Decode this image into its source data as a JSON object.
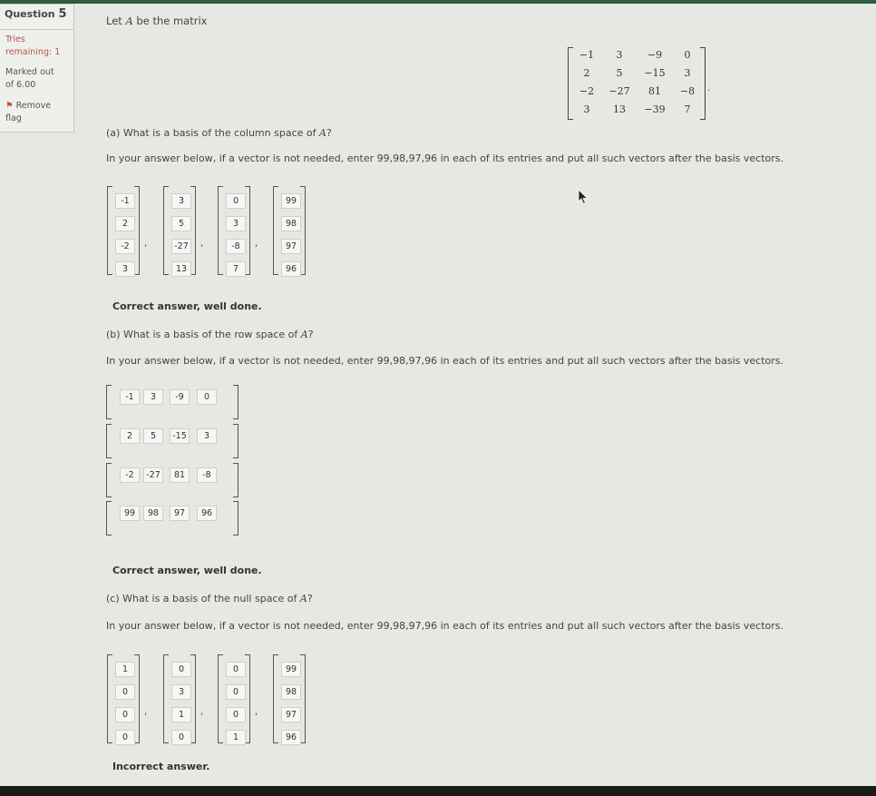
{
  "sidebar": {
    "question_label": "Question",
    "question_number": "5",
    "tries_line1": "Tries",
    "tries_line2": "remaining: 1",
    "marked_line1": "Marked out",
    "marked_line2": "of 6.00",
    "flag_label": "Remove",
    "flag_label2": "flag"
  },
  "intro": {
    "prefix": "Let",
    "var": "A",
    "suffix": "be the matrix"
  },
  "matrix_A": [
    [
      "−1",
      "3",
      "−9",
      "0"
    ],
    [
      "2",
      "5",
      "−15",
      "3"
    ],
    [
      "−2",
      "−27",
      "81",
      "−8"
    ],
    [
      "3",
      "13",
      "−39",
      "7"
    ]
  ],
  "instruction": "In your answer below, if a vector is not needed, enter 99,98,97,96 in each of its entries and put all such vectors after the basis vectors.",
  "part_a": {
    "question_prefix": "(a) What is a basis of the column space of",
    "var": "A",
    "qmark": "?",
    "vectors": [
      [
        "-1",
        "2",
        "-2",
        "3"
      ],
      [
        "3",
        "5",
        "-27",
        "13"
      ],
      [
        "0",
        "3",
        "-8",
        "7"
      ],
      [
        "99",
        "98",
        "97",
        "96"
      ]
    ],
    "feedback": "Correct answer, well done."
  },
  "part_b": {
    "question_prefix": "(b) What is a basis of the row space of",
    "var": "A",
    "qmark": "?",
    "vectors": [
      [
        "-1",
        "3",
        "-9",
        "0"
      ],
      [
        "2",
        "5",
        "-15",
        "3"
      ],
      [
        "-2",
        "-27",
        "81",
        "-8"
      ],
      [
        "99",
        "98",
        "97",
        "96"
      ]
    ],
    "feedback": "Correct answer, well done."
  },
  "part_c": {
    "question_prefix": "(c) What is a basis of the null space of",
    "var": "A",
    "qmark": "?",
    "vectors": [
      [
        "1",
        "0",
        "0",
        "0"
      ],
      [
        "0",
        "3",
        "1",
        "0"
      ],
      [
        "0",
        "0",
        "0",
        "1"
      ],
      [
        "99",
        "98",
        "97",
        "96"
      ]
    ],
    "feedback": "Incorrect answer."
  },
  "colors": {
    "top_bar": "#2d5d3e",
    "tries_red": "#c0504d",
    "background": "#e6e8e3"
  }
}
